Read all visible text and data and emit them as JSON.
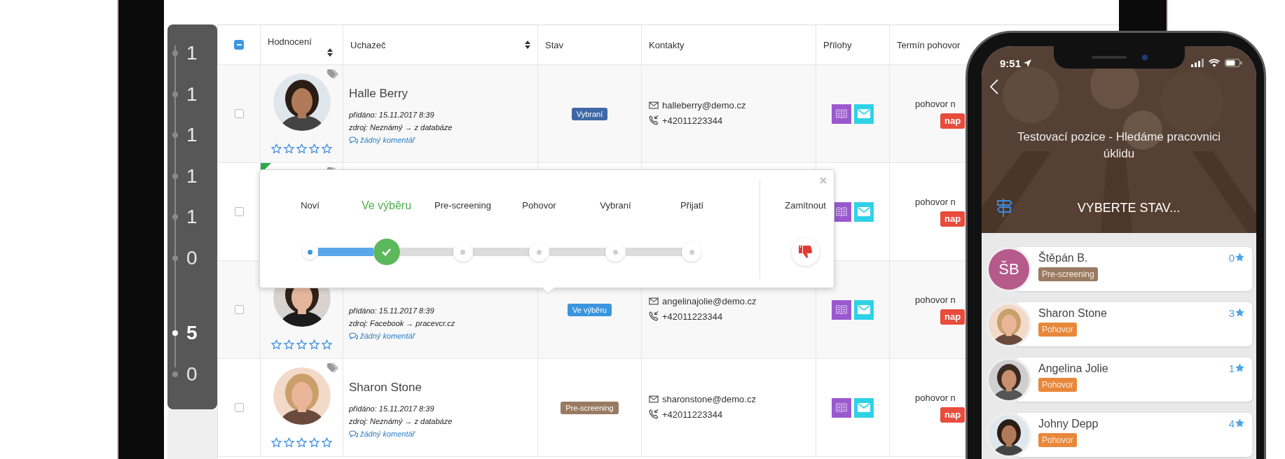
{
  "laptop": {
    "sidebar": {
      "items": [
        {
          "count": "1",
          "selected": false
        },
        {
          "count": "1",
          "selected": false
        },
        {
          "count": "1",
          "selected": false
        },
        {
          "count": "1",
          "selected": false
        },
        {
          "count": "1",
          "selected": false
        },
        {
          "count": "0",
          "selected": false
        },
        {
          "count": "5",
          "selected": true
        },
        {
          "count": "0",
          "selected": false
        }
      ]
    },
    "table": {
      "select_all": {
        "indeterminate": true
      },
      "columns": [
        {
          "label": "Hodnocení",
          "sortable": true
        },
        {
          "label": "Uchazeč",
          "sortable": true
        },
        {
          "label": "Stav"
        },
        {
          "label": "Kontakty"
        },
        {
          "label": "Přílohy"
        },
        {
          "label": "Termín pohovor"
        }
      ],
      "rows": [
        {
          "checked": false,
          "tagged": true,
          "photo": true,
          "name": "Halle Berry",
          "added": "přidáno: 15.11.2017 8:39",
          "source": "zdroj: Neznámý → z databáze",
          "comment": "žádný komentář",
          "stars": 0,
          "status": "Vybraní",
          "color": "#3e68a6",
          "email": "halleberry@demo.cz",
          "phone": "+42011223344",
          "attachments": true,
          "interview": "pohovor n",
          "interview_badge": "nap"
        },
        {
          "checked": false,
          "flagged": true,
          "tagged": true,
          "attachments": true,
          "interview": "pohovor n",
          "interview_badge": "nap"
        },
        {
          "checked": false,
          "photo": true,
          "added": "přidáno: 15.11.2017 8:39",
          "source": "zdroj: Facebook → pracevcr.cz",
          "comment": "žádný komentář",
          "stars": 0,
          "status": "Ve výběru",
          "color": "#3a95de",
          "email": "angelinajolie@demo.cz",
          "phone": "+42011223344",
          "attachments": true,
          "interview": "pohovor n",
          "interview_badge": "nap"
        },
        {
          "checked": false,
          "tagged": true,
          "photo": true,
          "name": "Sharon Stone",
          "added": "přidáno: 15.11.2017 8:39",
          "source": "zdroj: Neznámý → z databáze",
          "comment": "žádný komentář",
          "stars": 0,
          "status": "Pre-screening",
          "color": "#987a60",
          "email": "sharonstone@demo.cz",
          "phone": "+42011223344",
          "attachments": true,
          "interview": "pohovor n",
          "interview_badge": "nap"
        }
      ]
    },
    "status_popup": {
      "level": 0.2,
      "steps": [
        {
          "label": "Noví",
          "done": true,
          "selected": false
        },
        {
          "label": "Ve výběru",
          "selected": true
        },
        {
          "label": "Pre-screening",
          "done": false,
          "selected": false
        },
        {
          "label": "Pohovor",
          "done": false,
          "selected": false
        },
        {
          "label": "Vybraní",
          "done": false,
          "selected": false
        },
        {
          "label": "Přijatí",
          "done": false,
          "selected": false
        }
      ],
      "reject_label": "Zamítnout"
    }
  },
  "phone": {
    "time": "9:51",
    "title": "Testovací pozice - Hledáme pracovnici úklidu",
    "select_label": "VYBERTE STAV...",
    "candidates": [
      {
        "name": "Štěpán B.",
        "kind": "initials",
        "initials": "ŠB",
        "status": "Pre-screening",
        "color": "#9a7b62",
        "rating": "0"
      },
      {
        "name": "Sharon Stone",
        "status": "Pohovor",
        "color": "#e8883a",
        "rating": "3"
      },
      {
        "name": "Angelina Jolie",
        "status": "Pohovor",
        "color": "#e8883a",
        "rating": "1"
      },
      {
        "name": "Johny Depp",
        "status": "Pohovor",
        "color": "#e8883a",
        "rating": "4"
      }
    ]
  }
}
